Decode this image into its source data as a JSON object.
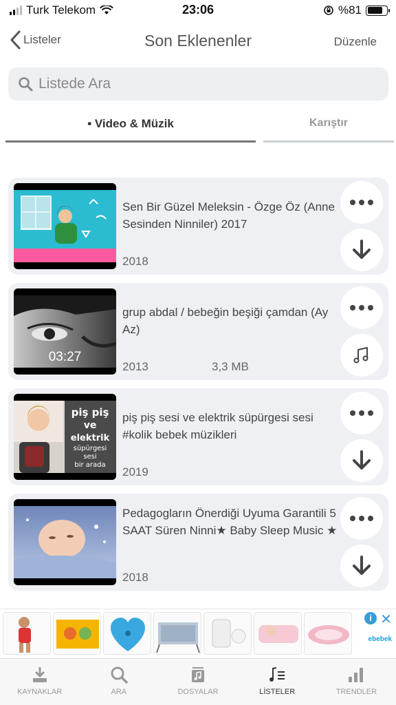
{
  "status": {
    "carrier": "Turk Telekom",
    "time": "23:06",
    "battery": "%81",
    "battery_level": 0.81
  },
  "nav": {
    "back_label": "Listeler",
    "title": "Son Eklenenler",
    "edit_label": "Düzenle"
  },
  "search": {
    "placeholder": "Listede Ara"
  },
  "tabs": [
    {
      "label": "• Video & Müzik",
      "active": true
    },
    {
      "label": "Karıştır",
      "active": false
    }
  ],
  "items": [
    {
      "title": "Sen Bir Güzel Meleksin - Özge Öz (Anne Sesinden Ninniler) 2017",
      "year": "2018",
      "size": "",
      "duration": "",
      "action_icon": "download-arrow-icon"
    },
    {
      "title": "grup abdal / bebeğin beşiği çamdan (Ay Az)",
      "year": "2013",
      "size": "3,3 MB",
      "duration": "03:27",
      "action_icon": "music-note-icon"
    },
    {
      "title": "piş piş sesi ve elektrik süpürgesi sesi #kolik bebek müzikleri",
      "year": "2019",
      "size": "",
      "duration": "",
      "action_icon": "download-arrow-icon"
    },
    {
      "title": "Pedagogların Önerdiği Uyuma Garantili 5 SAAT Süren Ninni★ Baby Sleep Music ★",
      "year": "2018",
      "size": "",
      "duration": "",
      "action_icon": "download-arrow-icon"
    }
  ],
  "ad": {
    "brand": "ebebek"
  },
  "tabbar": [
    {
      "label": "KAYNAKLAR",
      "icon": "download-tray-icon",
      "active": false
    },
    {
      "label": "ARA",
      "icon": "search-icon",
      "active": false
    },
    {
      "label": "DOSYALAR",
      "icon": "music-file-icon",
      "active": false
    },
    {
      "label": "LİSTELER",
      "icon": "music-list-icon",
      "active": true
    },
    {
      "label": "TRENDLER",
      "icon": "bar-chart-icon",
      "active": false
    }
  ]
}
